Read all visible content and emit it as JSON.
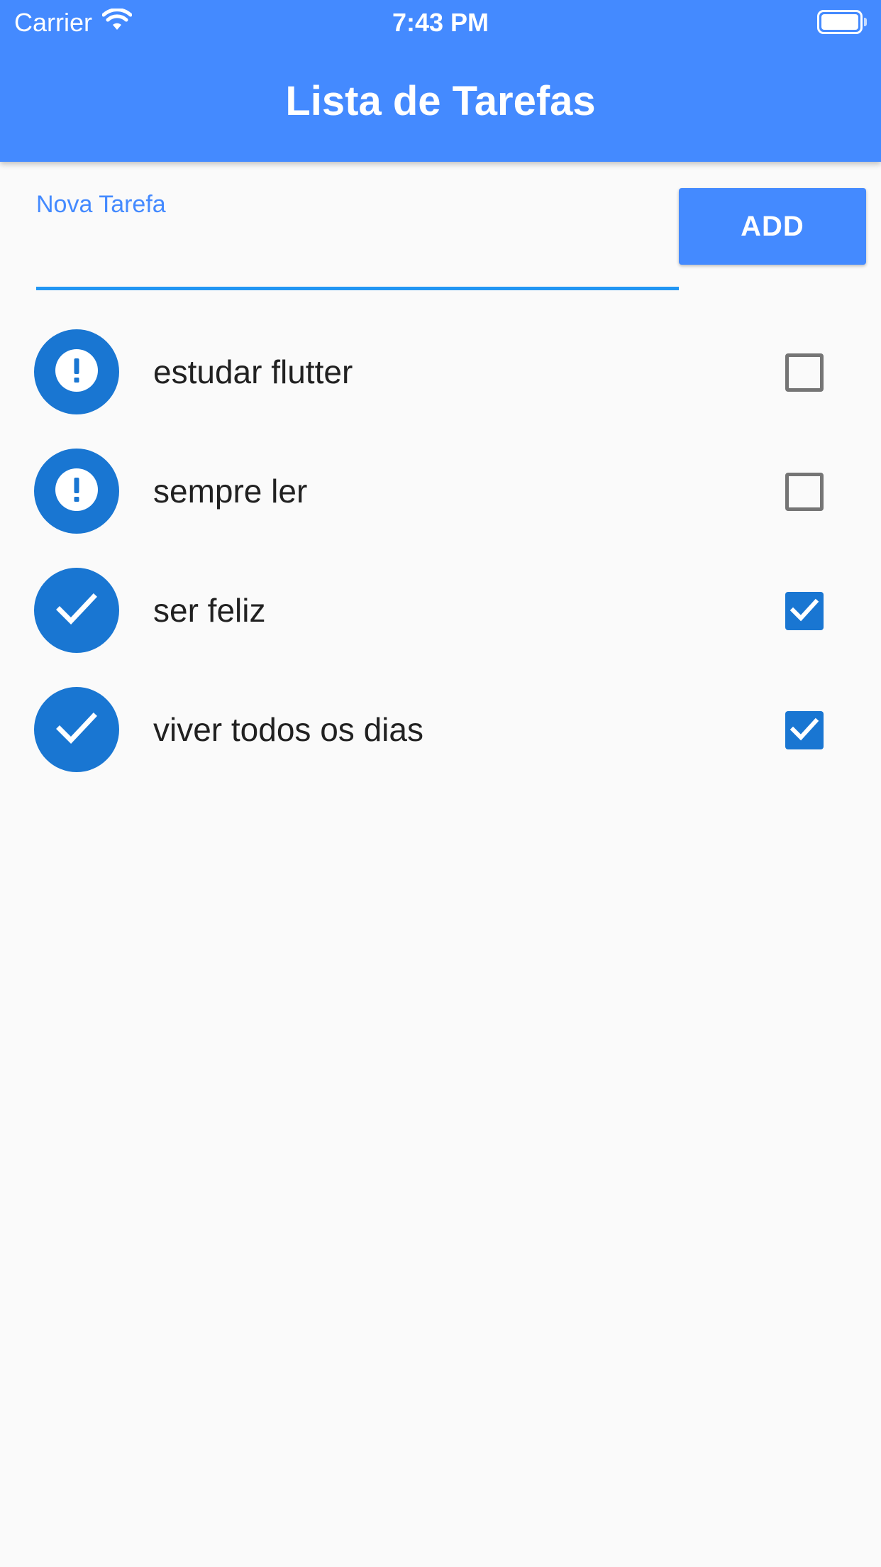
{
  "status_bar": {
    "carrier": "Carrier",
    "time": "7:43 PM"
  },
  "app_bar": {
    "title": "Lista de Tarefas",
    "color": "#448aff"
  },
  "new_task": {
    "label": "Nova Tarefa",
    "value": "",
    "button_label": "ADD"
  },
  "tasks": [
    {
      "label": "estudar flutter",
      "done": false,
      "icon": "error-icon"
    },
    {
      "label": "sempre ler",
      "done": false,
      "icon": "error-icon"
    },
    {
      "label": "ser feliz",
      "done": true,
      "icon": "check-icon"
    },
    {
      "label": "viver todos os dias",
      "done": true,
      "icon": "check-icon"
    }
  ],
  "colors": {
    "accent": "#448aff",
    "avatar": "#1976d2",
    "underline": "#2196f3",
    "background": "#fafafa"
  }
}
